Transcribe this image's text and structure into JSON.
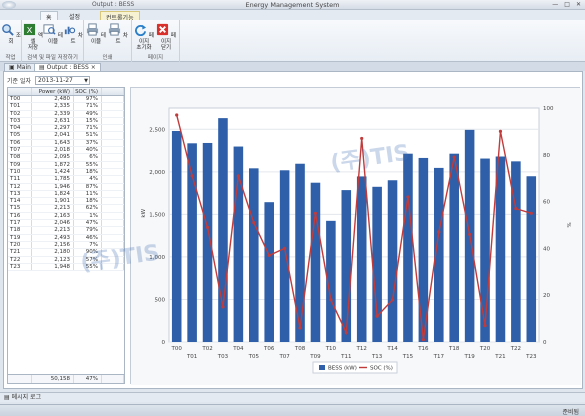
{
  "window": {
    "title": "Energy Management System",
    "context_label": "Output : BESS",
    "controls": [
      "—",
      "□",
      "✕"
    ]
  },
  "ribbon": {
    "tabs": [
      "홈",
      "설정",
      "컨트롤기능"
    ],
    "groups": [
      {
        "label": "작업",
        "buttons": [
          {
            "label": "조회",
            "icon": "search-icon"
          }
        ]
      },
      {
        "label": "검색 및 파일 저장하기",
        "buttons": [
          {
            "label": "엑셀\n저장",
            "icon": "excel-icon"
          },
          {
            "label": "테이블",
            "icon": "table-search-icon"
          },
          {
            "label": "차트",
            "icon": "chart-search-icon"
          }
        ]
      },
      {
        "label": "인쇄",
        "buttons": [
          {
            "label": "테이블",
            "icon": "table-print-icon"
          },
          {
            "label": "차트",
            "icon": "chart-print-icon"
          }
        ]
      },
      {
        "label": "페이지",
        "buttons": [
          {
            "label": "페이지\n초기화",
            "icon": "refresh-icon"
          },
          {
            "label": "페이지\n닫기",
            "icon": "close-icon"
          }
        ]
      }
    ]
  },
  "doc_tabs": [
    "Main",
    "Output : BESS"
  ],
  "filter": {
    "label": "기준 일자",
    "date": "2013-11-27"
  },
  "table": {
    "headers": [
      "",
      "Power (kW)",
      "SOC (%)"
    ],
    "rows": [
      [
        "T00",
        "2,480",
        "97%"
      ],
      [
        "T01",
        "2,335",
        "71%"
      ],
      [
        "T02",
        "2,339",
        "49%"
      ],
      [
        "T03",
        "2,631",
        "15%"
      ],
      [
        "T04",
        "2,297",
        "71%"
      ],
      [
        "T05",
        "2,041",
        "51%"
      ],
      [
        "T06",
        "1,643",
        "37%"
      ],
      [
        "T07",
        "2,018",
        "40%"
      ],
      [
        "T08",
        "2,095",
        "6%"
      ],
      [
        "T09",
        "1,872",
        "55%"
      ],
      [
        "T10",
        "1,424",
        "18%"
      ],
      [
        "T11",
        "1,785",
        "4%"
      ],
      [
        "T12",
        "1,946",
        "87%"
      ],
      [
        "T13",
        "1,824",
        "11%"
      ],
      [
        "T14",
        "1,901",
        "18%"
      ],
      [
        "T15",
        "2,213",
        "62%"
      ],
      [
        "T16",
        "2,163",
        "1%"
      ],
      [
        "T17",
        "2,046",
        "47%"
      ],
      [
        "T18",
        "2,213",
        "79%"
      ],
      [
        "T19",
        "2,493",
        "46%"
      ],
      [
        "T20",
        "2,156",
        "7%"
      ],
      [
        "T21",
        "2,180",
        "90%"
      ],
      [
        "T22",
        "2,123",
        "57%"
      ],
      [
        "T23",
        "1,948",
        "55%"
      ]
    ],
    "footer": [
      "",
      "50,158",
      "47%"
    ]
  },
  "chart_data": {
    "type": "bar",
    "categories": [
      "T00",
      "T01",
      "T02",
      "T03",
      "T04",
      "T05",
      "T06",
      "T07",
      "T08",
      "T09",
      "T10",
      "T11",
      "T12",
      "T13",
      "T14",
      "T15",
      "T16",
      "T17",
      "T18",
      "T19",
      "T20",
      "T21",
      "T22",
      "T23"
    ],
    "x_tick_labels": [
      "T00",
      "T02",
      "T04",
      "T06",
      "T08",
      "T10",
      "T12",
      "T14",
      "T16",
      "T18",
      "T20",
      "T22",
      "T01",
      "T03",
      "T05",
      "T07",
      "T09",
      "T11",
      "T13",
      "T15",
      "T17",
      "T19",
      "T21",
      "T23"
    ],
    "series": [
      {
        "name": "BESS (kW)",
        "type": "bar",
        "axis": "left",
        "color": "#2e5fa8",
        "values": [
          2480,
          2335,
          2339,
          2631,
          2297,
          2041,
          1643,
          2018,
          2095,
          1872,
          1424,
          1785,
          1946,
          1824,
          1901,
          2213,
          2163,
          2046,
          2213,
          2493,
          2156,
          2180,
          2123,
          1948
        ]
      },
      {
        "name": "SOC (%)",
        "type": "line",
        "axis": "right",
        "color": "#c23b3b",
        "values": [
          97,
          71,
          49,
          15,
          71,
          51,
          37,
          40,
          6,
          55,
          18,
          4,
          87,
          11,
          18,
          62,
          1,
          47,
          79,
          46,
          7,
          90,
          57,
          55
        ]
      }
    ],
    "ylabel_left": "kW",
    "ylabel_right": "%",
    "ylim_left": [
      0,
      2750
    ],
    "yticks_left": [
      "0",
      "500",
      "1,000",
      "1,500",
      "2,000",
      "2,500"
    ],
    "ylim_right": [
      0,
      100
    ],
    "yticks_right": [
      "0",
      "20",
      "40",
      "60",
      "80",
      "100"
    ],
    "grid": true,
    "legend": "bottom-center"
  },
  "status": {
    "message_area": "메시지 로그",
    "hint": "준비됨"
  },
  "watermark": "(주)TIS"
}
